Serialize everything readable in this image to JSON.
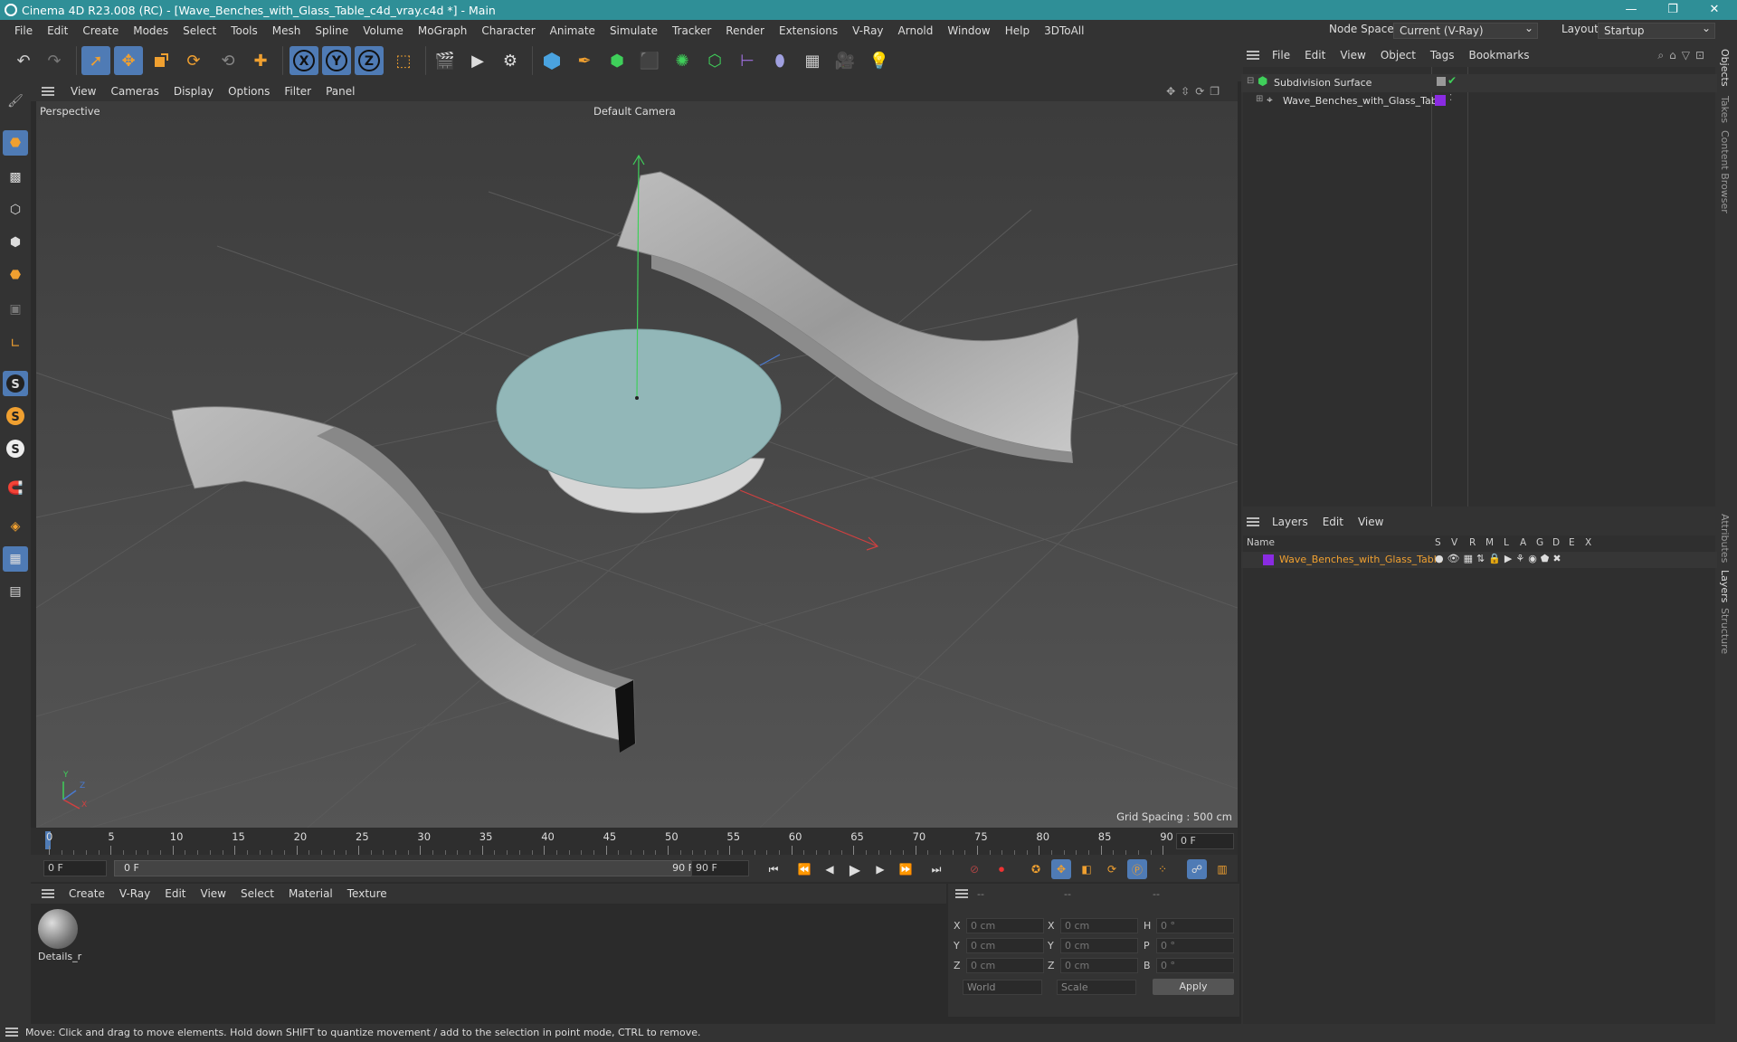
{
  "window": {
    "title": "Cinema 4D R23.008 (RC) - [Wave_Benches_with_Glass_Table_c4d_vray.c4d *] - Main",
    "buttons": [
      "—",
      "❐",
      "✕"
    ]
  },
  "menubar": {
    "items": [
      "File",
      "Edit",
      "Create",
      "Modes",
      "Select",
      "Tools",
      "Mesh",
      "Spline",
      "Volume",
      "MoGraph",
      "Character",
      "Animate",
      "Simulate",
      "Tracker",
      "Render",
      "Extensions",
      "V-Ray",
      "Arnold",
      "Window",
      "Help",
      "3DToAll"
    ],
    "node_space_label": "Node Space:",
    "node_space_value": "Current (V-Ray)",
    "layout_label": "Layout:",
    "layout_value": "Startup"
  },
  "toolbar": {
    "axis_x": "X",
    "axis_y": "Y",
    "axis_z": "Z"
  },
  "left_tools": {
    "s_labels": [
      "S",
      "S",
      "S"
    ]
  },
  "viewport": {
    "menu": [
      "View",
      "Cameras",
      "Display",
      "Options",
      "Filter",
      "Panel"
    ],
    "perspective_label": "Perspective",
    "camera_label": "Default Camera",
    "grid_spacing": "Grid Spacing : 500 cm",
    "axis_y": "Y",
    "axis_z": "Z",
    "axis_x": "X"
  },
  "timeline": {
    "ticks": [
      "0",
      "5",
      "10",
      "15",
      "20",
      "25",
      "30",
      "35",
      "40",
      "45",
      "50",
      "55",
      "60",
      "65",
      "70",
      "75",
      "80",
      "85",
      "90"
    ],
    "current_frame_right": "0 F",
    "start_field": "0 F",
    "range_start": "0 F",
    "range_end": "90 F",
    "end_field": "90 F"
  },
  "material_manager": {
    "menu": [
      "Create",
      "V-Ray",
      "Edit",
      "View",
      "Select",
      "Material",
      "Texture"
    ],
    "material_name": "Details_r"
  },
  "coordinates": {
    "header": [
      "--",
      "--",
      "--"
    ],
    "rows": [
      {
        "l1": "X",
        "v1": "0 cm",
        "l2": "X",
        "v2": "0 cm",
        "l3": "H",
        "v3": "0 °"
      },
      {
        "l1": "Y",
        "v1": "0 cm",
        "l2": "Y",
        "v2": "0 cm",
        "l3": "P",
        "v3": "0 °"
      },
      {
        "l1": "Z",
        "v1": "0 cm",
        "l2": "Z",
        "v2": "0 cm",
        "l3": "B",
        "v3": "0 °"
      }
    ],
    "world_dropdown": "World",
    "scale_dropdown": "Scale",
    "apply_label": "Apply"
  },
  "object_manager": {
    "menu": [
      "File",
      "Edit",
      "View",
      "Object",
      "Tags",
      "Bookmarks"
    ],
    "objects": [
      "Subdivision Surface",
      "Wave_Benches_with_Glass_Table"
    ]
  },
  "layer_manager": {
    "menu": [
      "Layers",
      "Edit",
      "View"
    ],
    "columns": [
      "Name",
      "S",
      "V",
      "R",
      "M",
      "L",
      "A",
      "G",
      "D",
      "E",
      "X"
    ],
    "layer_name": "Wave_Benches_with_Glass_Table",
    "layer_color": "#8a2be2"
  },
  "right_tabs": [
    "Objects",
    "Takes",
    "Content Browser",
    "Attributes",
    "Layers",
    "Structure"
  ],
  "status": {
    "message": "Move: Click and drag to move elements. Hold down SHIFT to quantize movement / add to the selection in point mode, CTRL to remove."
  },
  "colors": {
    "titlebar": "#2f8f97",
    "selected_tool": "#4f7bb5",
    "orange_accent": "#f0a030"
  }
}
